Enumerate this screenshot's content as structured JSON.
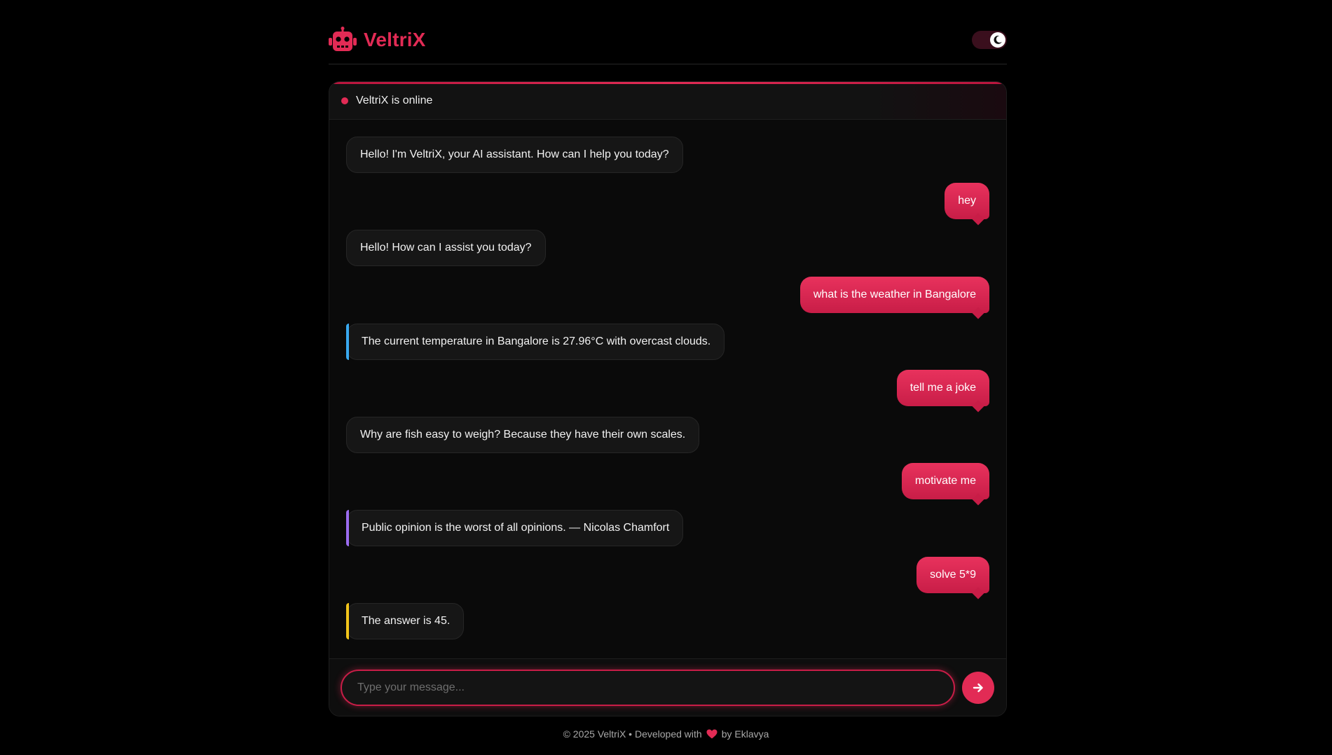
{
  "header": {
    "brand_name": "VeltriX",
    "brand_icon": "robot-icon",
    "theme_toggle_icon": "moon-icon",
    "brand_color": "#e22b55"
  },
  "status": {
    "text": "VeltriX is online"
  },
  "messages": [
    {
      "role": "bot",
      "text": "Hello! I'm VeltriX, your AI assistant. How can I help you today?"
    },
    {
      "role": "user",
      "text": "hey"
    },
    {
      "role": "bot",
      "text": "Hello! How can I assist you today?"
    },
    {
      "role": "user",
      "text": "what is the weather in Bangalore"
    },
    {
      "role": "bot",
      "accent": "#39a9f0",
      "text": "The current temperature in Bangalore is 27.96°C with overcast clouds."
    },
    {
      "role": "user",
      "text": "tell me a joke"
    },
    {
      "role": "bot",
      "text": "Why are fish easy to weigh? Because they have their own scales."
    },
    {
      "role": "user",
      "text": "motivate me"
    },
    {
      "role": "bot",
      "accent": "#9b6cf0",
      "text": "Public opinion is the worst of all opinions. — Nicolas Chamfort"
    },
    {
      "role": "user",
      "text": "solve 5*9"
    },
    {
      "role": "bot",
      "accent": "#f2c41a",
      "text": "The answer is 45."
    }
  ],
  "input": {
    "placeholder": "Type your message...",
    "value": ""
  },
  "send_button_icon": "arrow-right-icon",
  "footer": {
    "prefix": "© 2025 VeltriX • Developed with",
    "heart_icon": "heart-icon",
    "suffix": "by Eklavya"
  }
}
